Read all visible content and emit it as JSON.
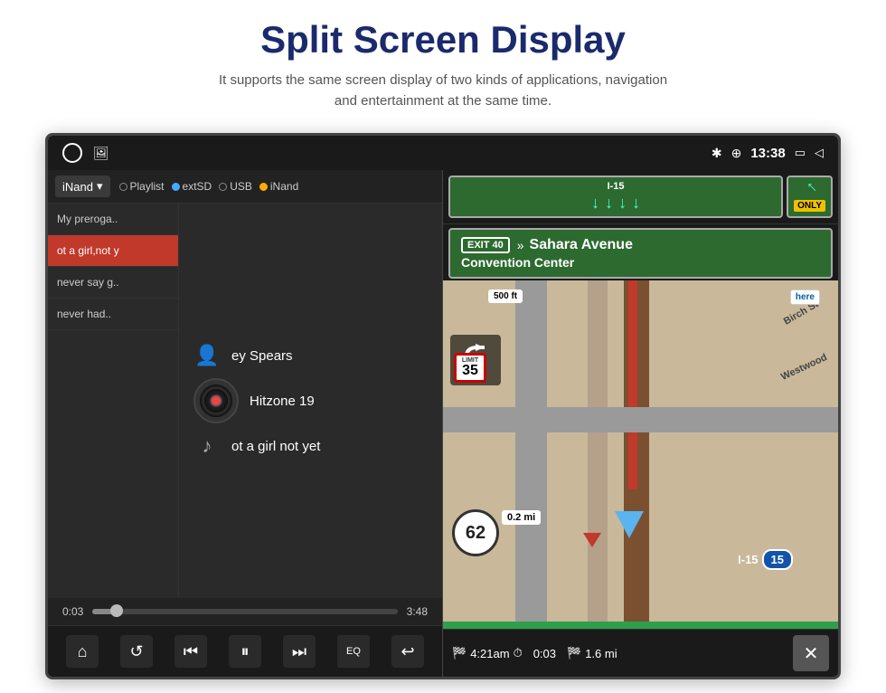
{
  "header": {
    "title": "Split Screen Display",
    "subtitle": "It supports the same screen display of two kinds of applications, navigation and entertainment at the same time."
  },
  "statusBar": {
    "time": "13:38",
    "bluetooth_icon": "✳",
    "location_icon": "⊕",
    "window_icon": "▭",
    "back_icon": "◁"
  },
  "musicPlayer": {
    "source_dropdown_label": "iNand",
    "sources": [
      "Playlist",
      "extSD",
      "USB",
      "iNand"
    ],
    "playlist": [
      {
        "label": "My preroga..",
        "active": false
      },
      {
        "label": "ot a girl,not y",
        "active": true
      },
      {
        "label": "never say g..",
        "active": false
      },
      {
        "label": "never had..",
        "active": false
      }
    ],
    "artist": "ey Spears",
    "album": "Hitzone 19",
    "song": "ot a girl not yet",
    "current_time": "0:03",
    "total_time": "3:48",
    "progress_pct": 8,
    "controls": {
      "home": "⌂",
      "repeat": "↺",
      "prev": "⏮",
      "play_pause": "⏸",
      "next": "⏭",
      "eq": "EQ",
      "back": "↩"
    }
  },
  "navigation": {
    "highway_sign": {
      "route": "I-15",
      "directions": [
        "↓",
        "↓",
        "↓",
        "↓"
      ],
      "only_arrow": "↗",
      "only_label": "ONLY"
    },
    "exit_sign": {
      "exit_number": "EXIT 40",
      "street": "Sahara Avenue",
      "place": "Convention Center"
    },
    "map": {
      "speed_limit": "62",
      "route_label": "I-15",
      "highway_shield": "15",
      "distance_to_turn": "0.2 mi",
      "speed_ft": "500 ft",
      "road_label": "Birch St",
      "road_label2": "Westwood"
    },
    "bottom_bar": {
      "eta": "4:21am",
      "travel_time": "0:03",
      "distance": "1.6 mi",
      "close_icon": "✕"
    }
  }
}
